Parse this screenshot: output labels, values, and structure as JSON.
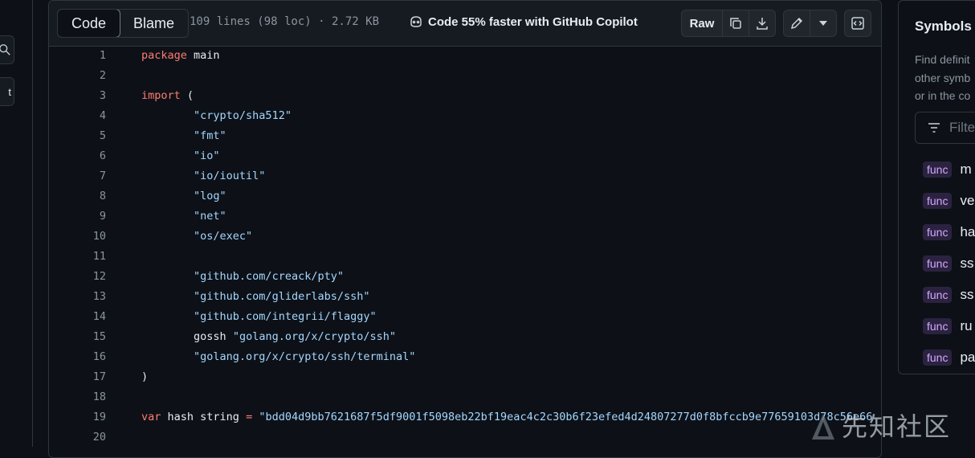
{
  "view_tabs": {
    "code": "Code",
    "blame": "Blame"
  },
  "file_info": "109 lines (98 loc) · 2.72 KB",
  "copilot_text": "Code 55% faster with GitHub Copilot",
  "toolbar": {
    "raw_label": "Raw"
  },
  "left_rail": {
    "t_label": "t"
  },
  "code_lines": [
    {
      "n": "1",
      "tokens": [
        {
          "t": "package",
          "c": "kw"
        },
        {
          "t": " main",
          "c": "id"
        }
      ]
    },
    {
      "n": "2",
      "tokens": []
    },
    {
      "n": "3",
      "tokens": [
        {
          "t": "import",
          "c": "kw"
        },
        {
          "t": " (",
          "c": "id"
        }
      ]
    },
    {
      "n": "4",
      "tokens": [
        {
          "t": "\t",
          "c": "id"
        },
        {
          "t": "\"crypto/sha512\"",
          "c": "str"
        }
      ]
    },
    {
      "n": "5",
      "tokens": [
        {
          "t": "\t",
          "c": "id"
        },
        {
          "t": "\"fmt\"",
          "c": "str"
        }
      ]
    },
    {
      "n": "6",
      "tokens": [
        {
          "t": "\t",
          "c": "id"
        },
        {
          "t": "\"io\"",
          "c": "str"
        }
      ]
    },
    {
      "n": "7",
      "tokens": [
        {
          "t": "\t",
          "c": "id"
        },
        {
          "t": "\"io/ioutil\"",
          "c": "str"
        }
      ]
    },
    {
      "n": "8",
      "tokens": [
        {
          "t": "\t",
          "c": "id"
        },
        {
          "t": "\"log\"",
          "c": "str"
        }
      ]
    },
    {
      "n": "9",
      "tokens": [
        {
          "t": "\t",
          "c": "id"
        },
        {
          "t": "\"net\"",
          "c": "str"
        }
      ]
    },
    {
      "n": "10",
      "tokens": [
        {
          "t": "\t",
          "c": "id"
        },
        {
          "t": "\"os/exec\"",
          "c": "str"
        }
      ]
    },
    {
      "n": "11",
      "tokens": []
    },
    {
      "n": "12",
      "tokens": [
        {
          "t": "\t",
          "c": "id"
        },
        {
          "t": "\"github.com/creack/pty\"",
          "c": "str"
        }
      ]
    },
    {
      "n": "13",
      "tokens": [
        {
          "t": "\t",
          "c": "id"
        },
        {
          "t": "\"github.com/gliderlabs/ssh\"",
          "c": "str"
        }
      ]
    },
    {
      "n": "14",
      "tokens": [
        {
          "t": "\t",
          "c": "id"
        },
        {
          "t": "\"github.com/integrii/flaggy\"",
          "c": "str"
        }
      ]
    },
    {
      "n": "15",
      "tokens": [
        {
          "t": "\tgossh ",
          "c": "id"
        },
        {
          "t": "\"golang.org/x/crypto/ssh\"",
          "c": "str"
        }
      ]
    },
    {
      "n": "16",
      "tokens": [
        {
          "t": "\t",
          "c": "id"
        },
        {
          "t": "\"golang.org/x/crypto/ssh/terminal\"",
          "c": "str"
        }
      ]
    },
    {
      "n": "17",
      "tokens": [
        {
          "t": ")",
          "c": "id"
        }
      ]
    },
    {
      "n": "18",
      "tokens": []
    },
    {
      "n": "19",
      "tokens": [
        {
          "t": "var",
          "c": "kw"
        },
        {
          "t": " hash string ",
          "c": "id"
        },
        {
          "t": "=",
          "c": "kw"
        },
        {
          "t": " \"bdd04d9bb7621687f5df9001f5098eb22bf19eac4c2c30b6f23efed4d24807277d0f8bfccb9e77659103d78c56e66",
          "c": "str"
        }
      ]
    },
    {
      "n": "20",
      "tokens": []
    }
  ],
  "symbols": {
    "title": "Symbols",
    "desc_lines": [
      "Find definit",
      "other symb",
      "or in the co"
    ],
    "filter_placeholder": "Filte",
    "items": [
      {
        "kind": "func",
        "name": "m"
      },
      {
        "kind": "func",
        "name": "ve"
      },
      {
        "kind": "func",
        "name": "ha"
      },
      {
        "kind": "func",
        "name": "ss"
      },
      {
        "kind": "func",
        "name": "ss"
      },
      {
        "kind": "func",
        "name": "ru"
      },
      {
        "kind": "func",
        "name": "pa"
      }
    ]
  },
  "watermark": {
    "text": "先知社区"
  },
  "colors": {
    "keyword": "#ff7b72",
    "string": "#a5d6ff",
    "text": "#e6edf3",
    "muted": "#8b949e",
    "background": "#0d1117",
    "border": "#30363d",
    "func_badge": "#d2a8ff"
  }
}
